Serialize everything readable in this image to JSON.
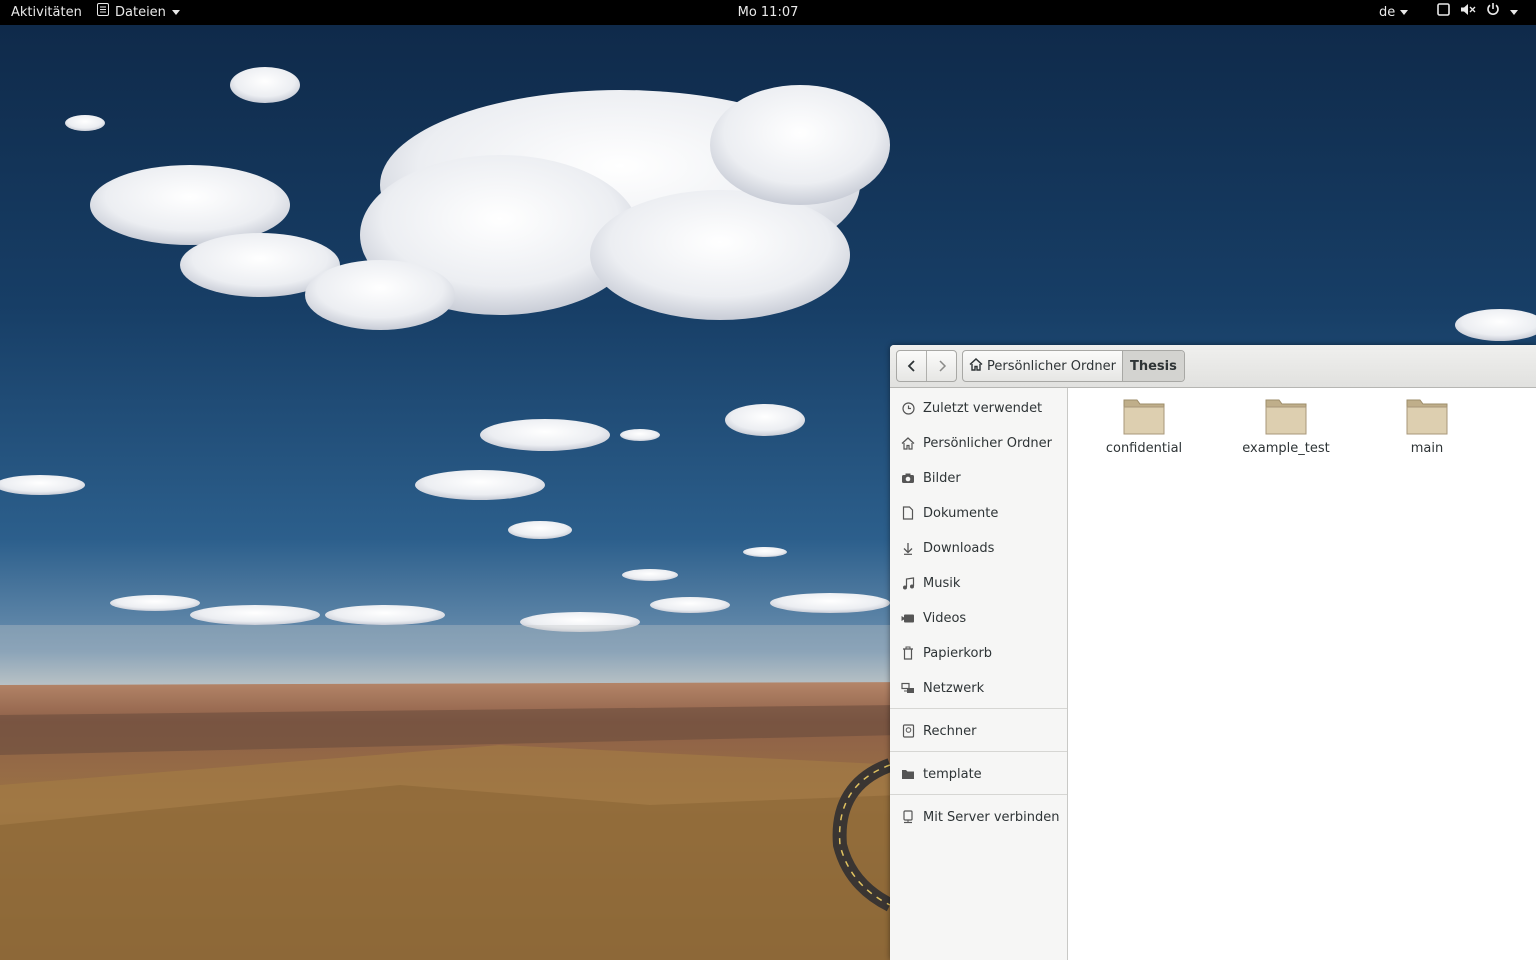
{
  "topbar": {
    "activities": "Aktivitäten",
    "app_menu": "Dateien",
    "clock": "Mo 11:07",
    "keyboard_layout": "de",
    "icons": [
      "window-icon",
      "volume-icon",
      "power-icon"
    ]
  },
  "file_manager": {
    "nav": {
      "back_icon": "chevron-left-icon",
      "forward_icon": "chevron-right-icon"
    },
    "path": [
      {
        "label": "Persönlicher Ordner",
        "icon": "home-icon"
      },
      {
        "label": "Thesis"
      }
    ],
    "sidebar": {
      "places": [
        {
          "label": "Zuletzt verwendet",
          "icon": "clock-icon"
        },
        {
          "label": "Persönlicher Ordner",
          "icon": "home-icon"
        },
        {
          "label": "Bilder",
          "icon": "camera-icon"
        },
        {
          "label": "Dokumente",
          "icon": "document-icon"
        },
        {
          "label": "Downloads",
          "icon": "download-icon"
        },
        {
          "label": "Musik",
          "icon": "music-icon"
        },
        {
          "label": "Videos",
          "icon": "video-icon"
        },
        {
          "label": "Papierkorb",
          "icon": "trash-icon"
        },
        {
          "label": "Netzwerk",
          "icon": "network-icon"
        }
      ],
      "devices": [
        {
          "label": "Rechner",
          "icon": "drive-icon"
        }
      ],
      "bookmarks": [
        {
          "label": "template",
          "icon": "folder-icon"
        }
      ],
      "other": [
        {
          "label": "Mit Server verbinden",
          "icon": "server-icon"
        }
      ]
    },
    "folders": [
      {
        "name": "confidential"
      },
      {
        "name": "example_test"
      },
      {
        "name": "main"
      }
    ]
  },
  "colors": {
    "topbar_bg": "#000000",
    "sky": "#173e66",
    "folder": "#d8c8a8"
  }
}
